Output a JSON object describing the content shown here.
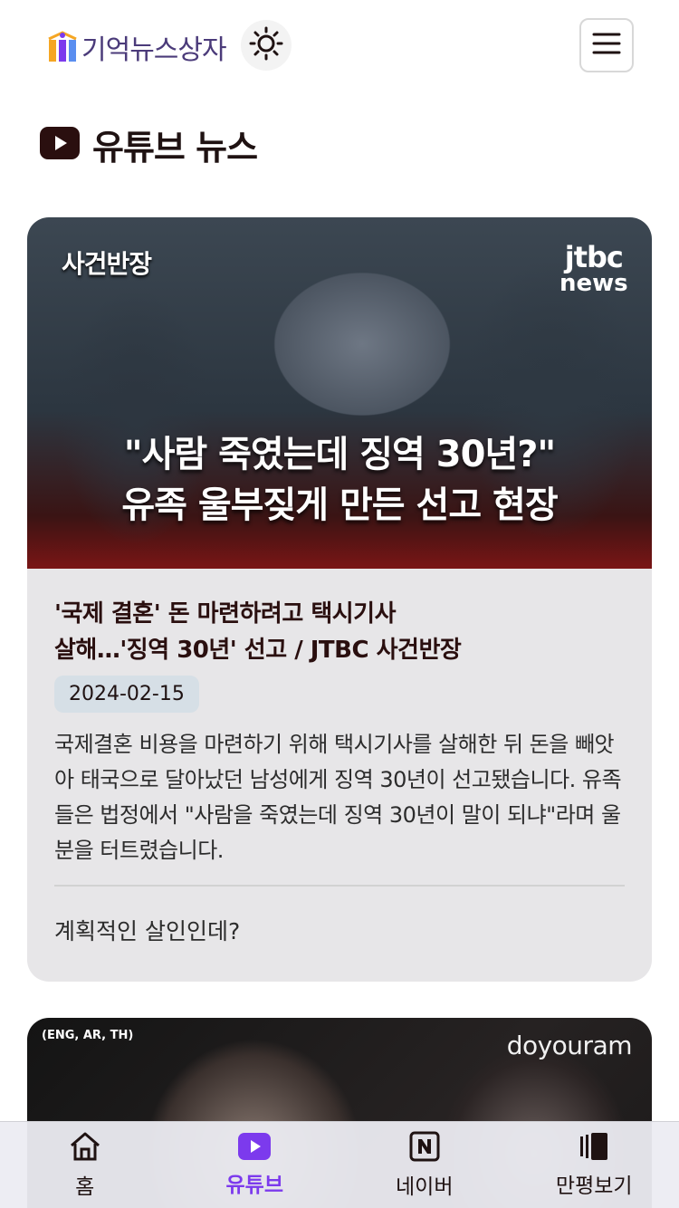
{
  "header": {
    "logo_text": "기억뉴스상자",
    "theme_icon": "sun-icon",
    "menu_icon": "hamburger-icon"
  },
  "section": {
    "title": "유튜브 뉴스",
    "icon": "youtube-icon"
  },
  "card": {
    "thumbnail": {
      "tag": "사건반장",
      "logo_line1": "jtbc",
      "logo_line2": "news",
      "headline_line1": "\"사람 죽였는데 징역 30년?\"",
      "headline_line2": "유족 울부짖게 만든 선고 현장"
    },
    "title_line1": "'국제 결혼' 돈 마련하려고 택시기사",
    "title_line2": "살해…'징역 30년' 선고 / JTBC 사건반장",
    "date": "2024-02-15",
    "description": "국제결혼 비용을 마련하기 위해 택시기사를 살해한 뒤 돈을 빼앗아 태국으로 달아났던 남성에게 징역 30년이 선고됐습니다. 유족들은 법정에서 \"사람을 죽였는데 징역 30년이 말이 되냐\"라며 울분을 터트렸습니다.",
    "note": "계획적인 살인인데?"
  },
  "card2": {
    "tag": "(ENG, AR, TH)",
    "brand": "doyouram"
  },
  "bottom_nav": {
    "items": [
      {
        "label": "홈",
        "icon": "home-icon"
      },
      {
        "label": "유튜브",
        "icon": "youtube-icon"
      },
      {
        "label": "네이버",
        "icon": "naver-icon"
      },
      {
        "label": "만평보기",
        "icon": "cartoon-icon"
      }
    ],
    "active_color": "#7c3aed"
  }
}
